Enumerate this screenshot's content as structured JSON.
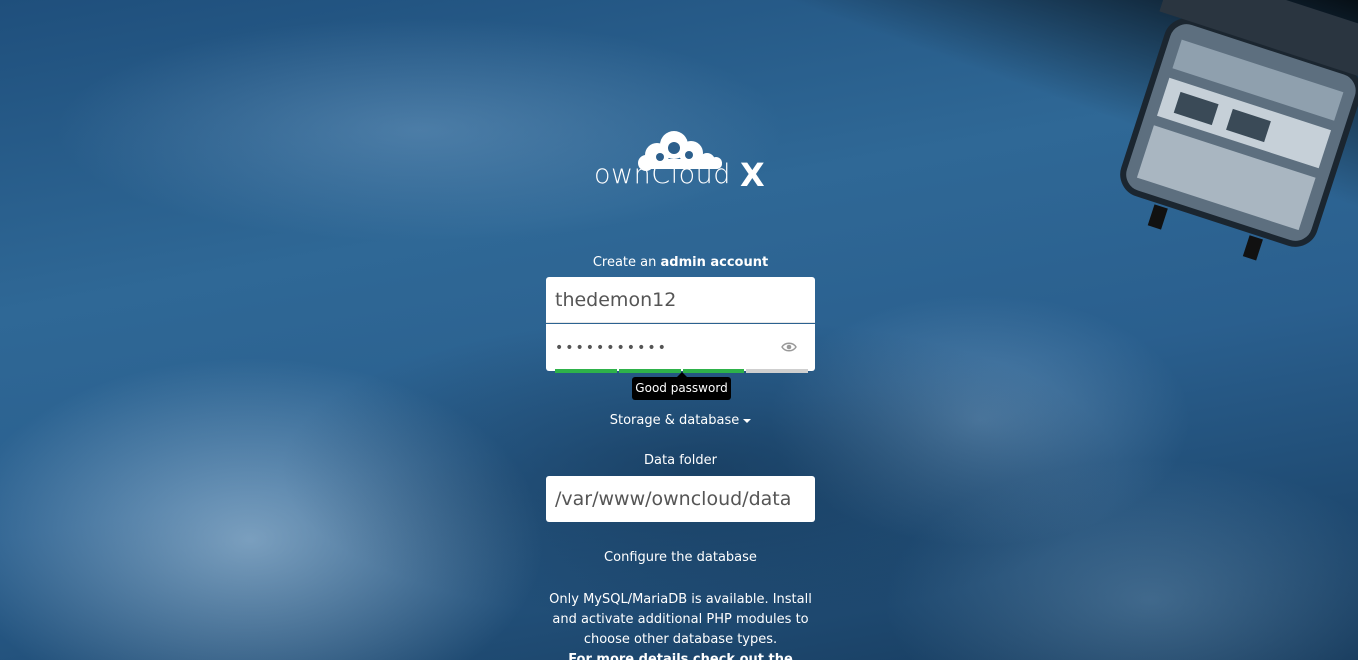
{
  "brand": {
    "name": "ownCloud",
    "suffix": "X"
  },
  "form": {
    "create_prefix": "Create an ",
    "create_bold": "admin account",
    "username_value": "thedemon12",
    "password_value": "•••••••••••",
    "password_strength_fraction": 0.75,
    "password_strength_label": "Good password",
    "storage_toggle_label": "Storage & database",
    "data_folder_label": "Data folder",
    "data_folder_value": "/var/www/owncloud/data",
    "configure_db_label": "Configure the database",
    "db_note_text": "Only MySQL/MariaDB is available. Install and activate additional PHP modules to choose other database types.",
    "db_note_link": "For more details check out the"
  },
  "colors": {
    "strength_good": "#2eb24a",
    "strength_empty": "#cfcfcf",
    "tooltip_bg": "#000000"
  },
  "icons": {
    "password_toggle": "eye-icon",
    "storage_toggle": "caret-down-icon",
    "logo": "cloud-logo-icon",
    "background_object": "satellite"
  }
}
